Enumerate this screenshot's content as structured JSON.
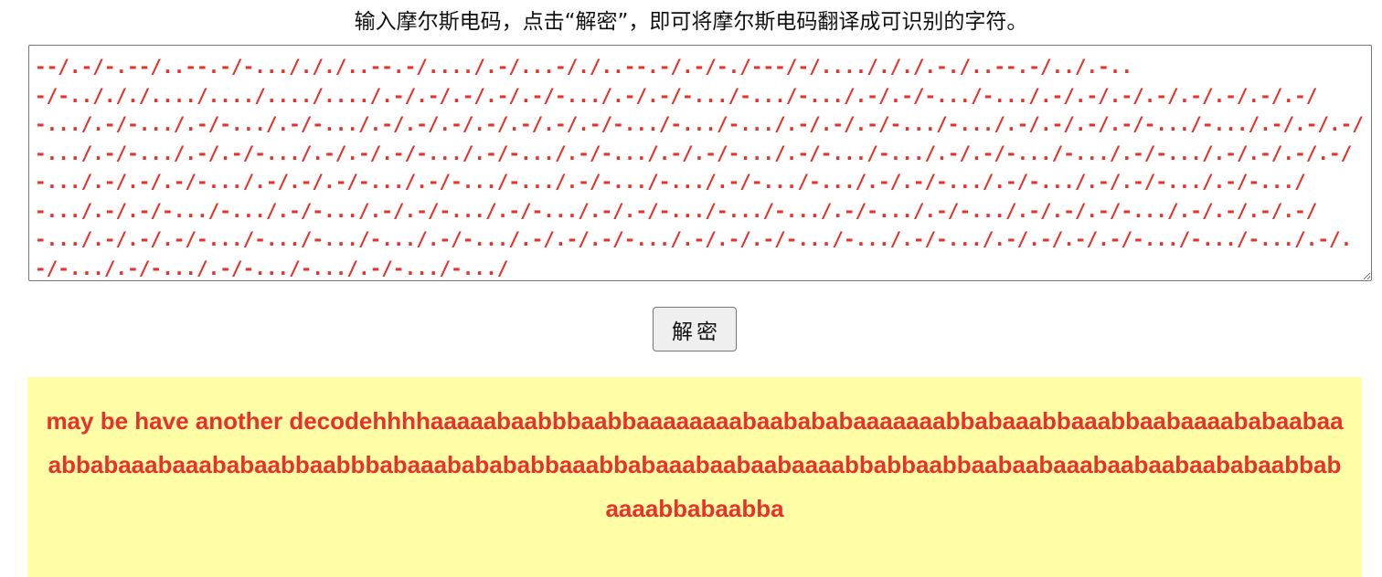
{
  "page": {
    "instruction": "输入摩尔斯电码，点击“解密”，即可将摩尔斯电码翻译成可识别的字符。"
  },
  "input": {
    "morse_code": "--/.-/-.--/..--.-/-.../././..--.-/..../.-/...-/./..--.-/.-/-./---/-/..../././.-./..--.-/../.-..\n-/-../././..../..../..../..../.-/.-/.-/.-/.-/-.../.-/.-/-.../-.../-.../.-/.-/-.../-.../.-/.-/.-/.-/.-/.-/.-/.-/-.../.-/-.../.-/-.../.-/-.../.-/.-/.-/.-/.-/.-/.-/-.../-.../-.../.-/.-/.-/-.../-.../.-/.-/.-/.-/-.../-.../.-/.-/.-/-.../.-/-.../.-/.-/-.../.-/.-/.-/-.../.-/-.../.-/-.../.-/.-/-.../.-/-.../-.../.-/.-/-.../-.../.-/-.../.-/.-/.-/.-/-.../.-/.-/.-/-.../.-/.-/.-/-.../.-/-.../-.../.-/-.../-.../.-/-.../-.../.-/.-/-.../.-/-.../.-/.-/-.../.-/-.../-.../.-/.-/-.../-.../.-/-.../.-/.-/-.../.-/-.../.-/.-/-.../-.../-.../.-/-.../.-/-.../.-/.-/.-/-.../.-/.-/.-/.-/-.../.-/.-/.-/-.../-.../-.../-.../.-/-.../.-/.-/.-/-.../.-/.-/.-/-.../-.../.-/-.../.-/.-/.-/.-/-.../-.../-.../.-/.-/-.../.-/-.../.-/-.../-.../.-/-.../-.../"
  },
  "buttons": {
    "decrypt_label": "解密"
  },
  "result": {
    "text": "may be have another decodehhhhaaaaabaabbbaabbaaaaaaaabaabababaaaaaaabbabaaabbaaabbaabaaaababaabaaabbabaaabaaababaabbaabbbabaaababababbaaabbabaaabaabaabaaaabbabbaabbaabaabaaabaabaabaababaabbabaaaabbabaabba"
  },
  "colors": {
    "morse_text": "#e8312a",
    "result_text": "#e8312a",
    "result_background": "#fffea7",
    "button_background": "#efefef"
  }
}
